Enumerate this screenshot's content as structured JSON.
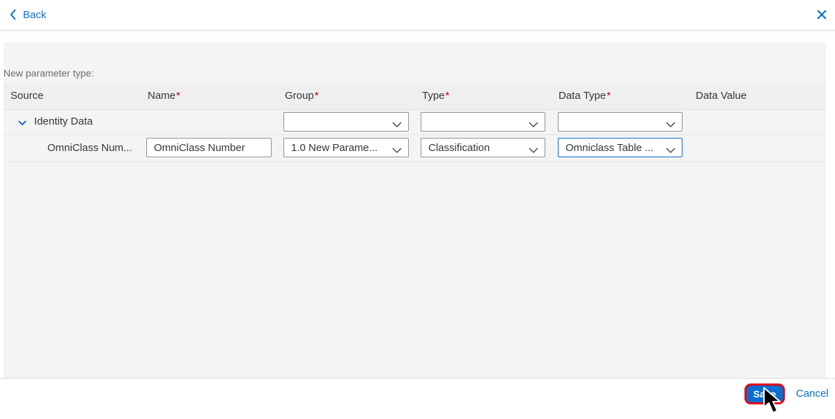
{
  "header": {
    "back_label": "Back",
    "back_icon": "chevron-left-icon",
    "close_icon": "close-icon"
  },
  "section": {
    "label": "New parameter type:"
  },
  "table": {
    "columns": [
      {
        "label": "Source",
        "required": false
      },
      {
        "label": "Name",
        "required": true
      },
      {
        "label": "Group",
        "required": true
      },
      {
        "label": "Type",
        "required": true
      },
      {
        "label": "Data Type",
        "required": true
      },
      {
        "label": "Data Value",
        "required": false
      }
    ],
    "required_marker": "*",
    "group_row": {
      "label": "Identity Data",
      "expanded": true,
      "group_value": "",
      "type_value": "",
      "data_type_value": ""
    },
    "param_row": {
      "source": "OmniClass Num...",
      "name_value": "OmniClass Number",
      "group_value": "1.0 New Parame...",
      "type_value": "Classification",
      "data_type_value": "Omniclass Table ...",
      "data_value": ""
    }
  },
  "footer": {
    "save_label": "Save",
    "cancel_label": "Cancel"
  },
  "colors": {
    "accent": "#0a6ed1",
    "required": "#bb0000",
    "highlight": "#e2001a"
  }
}
